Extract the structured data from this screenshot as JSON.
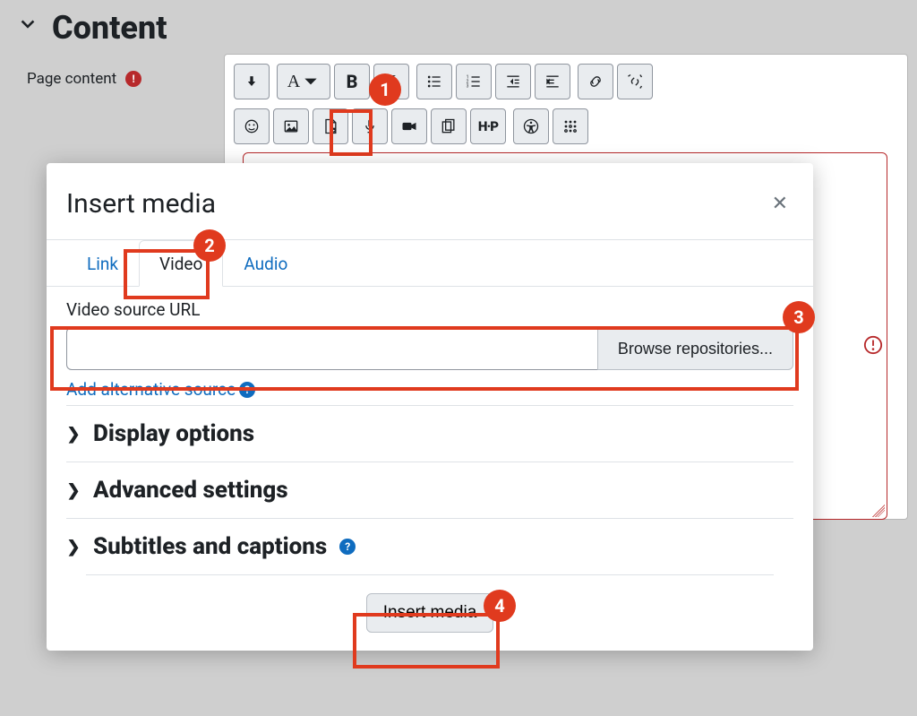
{
  "page": {
    "section_title": "Content",
    "field_label": "Page content"
  },
  "toolbar": {
    "row1": {
      "toggle": "↓",
      "font_letter": "A",
      "bold": "B",
      "italic": "I"
    },
    "h5p_label": "H·P"
  },
  "modal": {
    "title": "Insert media",
    "tabs": {
      "link": "Link",
      "video": "Video",
      "audio": "Audio"
    },
    "video": {
      "url_label": "Video source URL",
      "browse": "Browse repositories...",
      "add_source": "Add alternative source",
      "accordions": {
        "display": "Display options",
        "advanced": "Advanced settings",
        "subtitles": "Subtitles and captions"
      },
      "insert": "Insert media"
    }
  },
  "callouts": {
    "c1": "1",
    "c2": "2",
    "c3": "3",
    "c4": "4"
  }
}
